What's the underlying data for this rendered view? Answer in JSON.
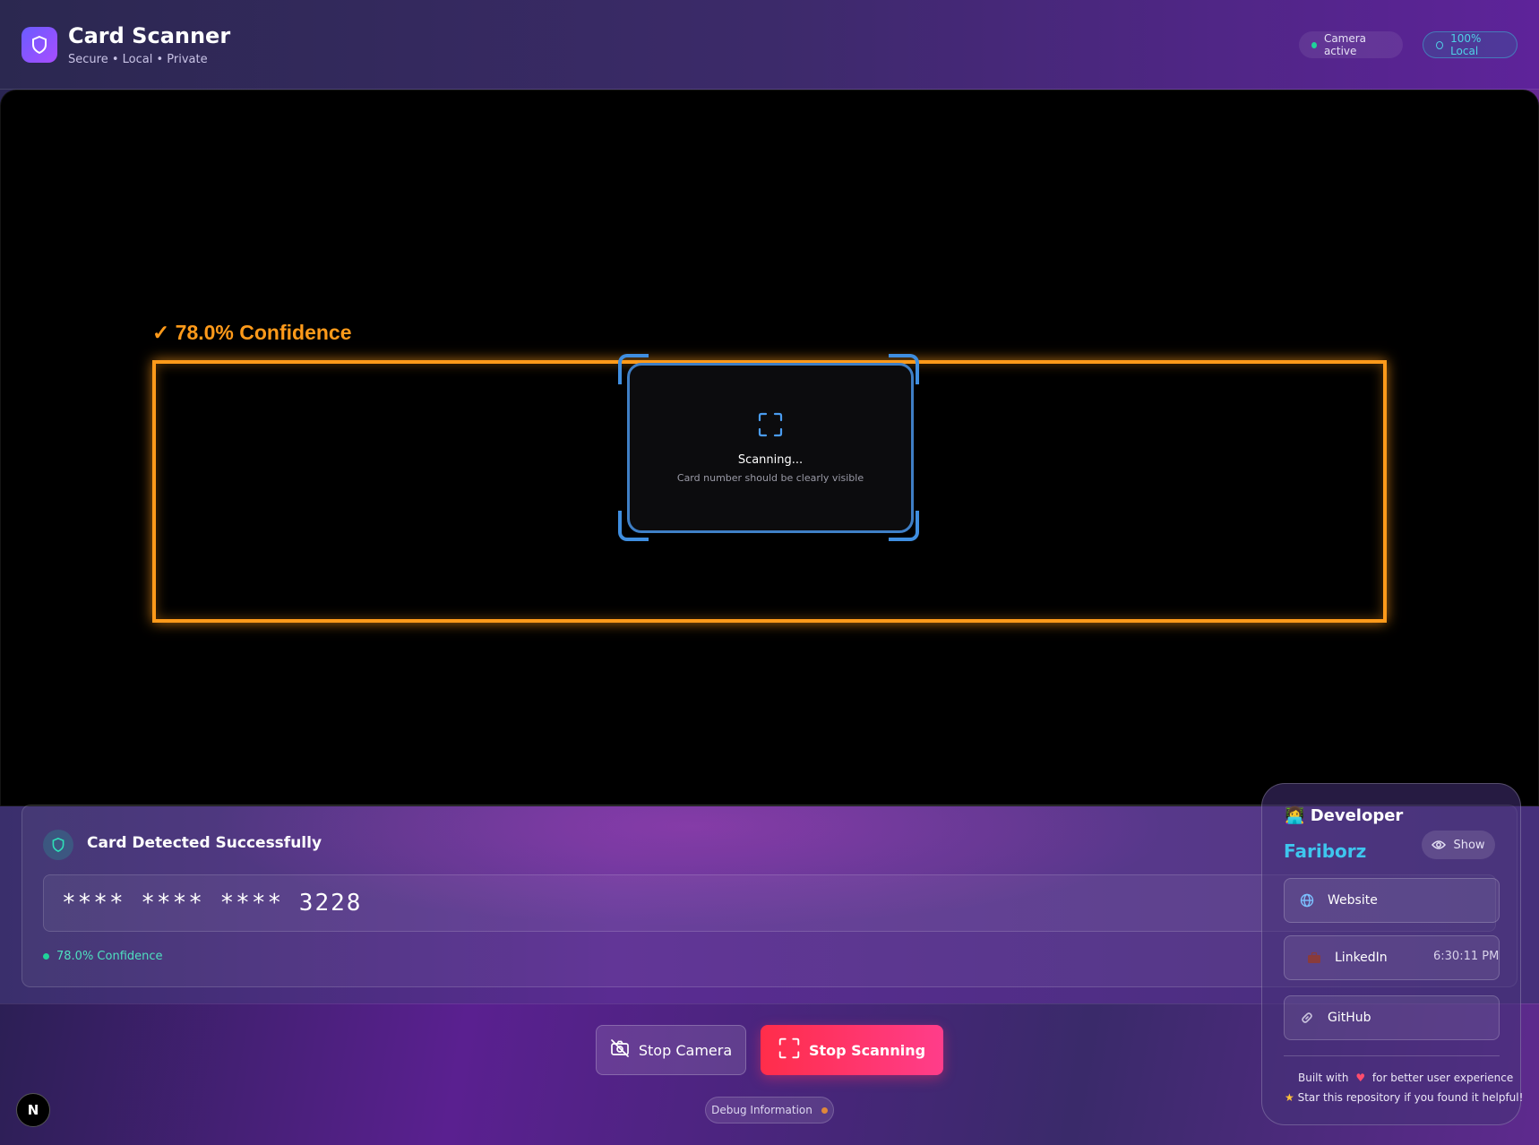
{
  "header": {
    "title": "Card Scanner",
    "subtitle": "Secure • Local • Private",
    "camera_status": "Camera active",
    "local_badge": "100% Local"
  },
  "viewport": {
    "confidence_label": "✓ 78.0% Confidence",
    "scan_title": "Scanning...",
    "scan_hint": "Card number should be clearly visible"
  },
  "result": {
    "title": "Card Detected Successfully",
    "card_number": "****  ****  ****  3228",
    "confidence": "78.0% Confidence"
  },
  "controls": {
    "stop_camera": "Stop Camera",
    "stop_scanning": "Stop Scanning",
    "debug": "Debug Information",
    "corner_badge": "N"
  },
  "developer": {
    "heading": "Developer",
    "heading_icon": "👩‍💻",
    "name": "Fariborz",
    "show": "Show",
    "links": [
      {
        "label": "Website",
        "icon": "globe-icon"
      },
      {
        "label": "LinkedIn",
        "icon": "briefcase-icon"
      },
      {
        "label": "GitHub",
        "icon": "link-icon"
      }
    ],
    "time": "6:30:11 PM",
    "footer_prefix": "Built with",
    "footer_suffix": "for better user experience",
    "footer_star": "Star this repository if you found it helpful!"
  },
  "colors": {
    "accent_orange": "#ff9a1a",
    "scan_blue": "#3f8ee0",
    "success_green": "#20d39a",
    "developer_name": "#3ec6ee",
    "stop_scan_gradient_start": "#ff2d4a",
    "stop_scan_gradient_end": "#ff3d8a"
  }
}
